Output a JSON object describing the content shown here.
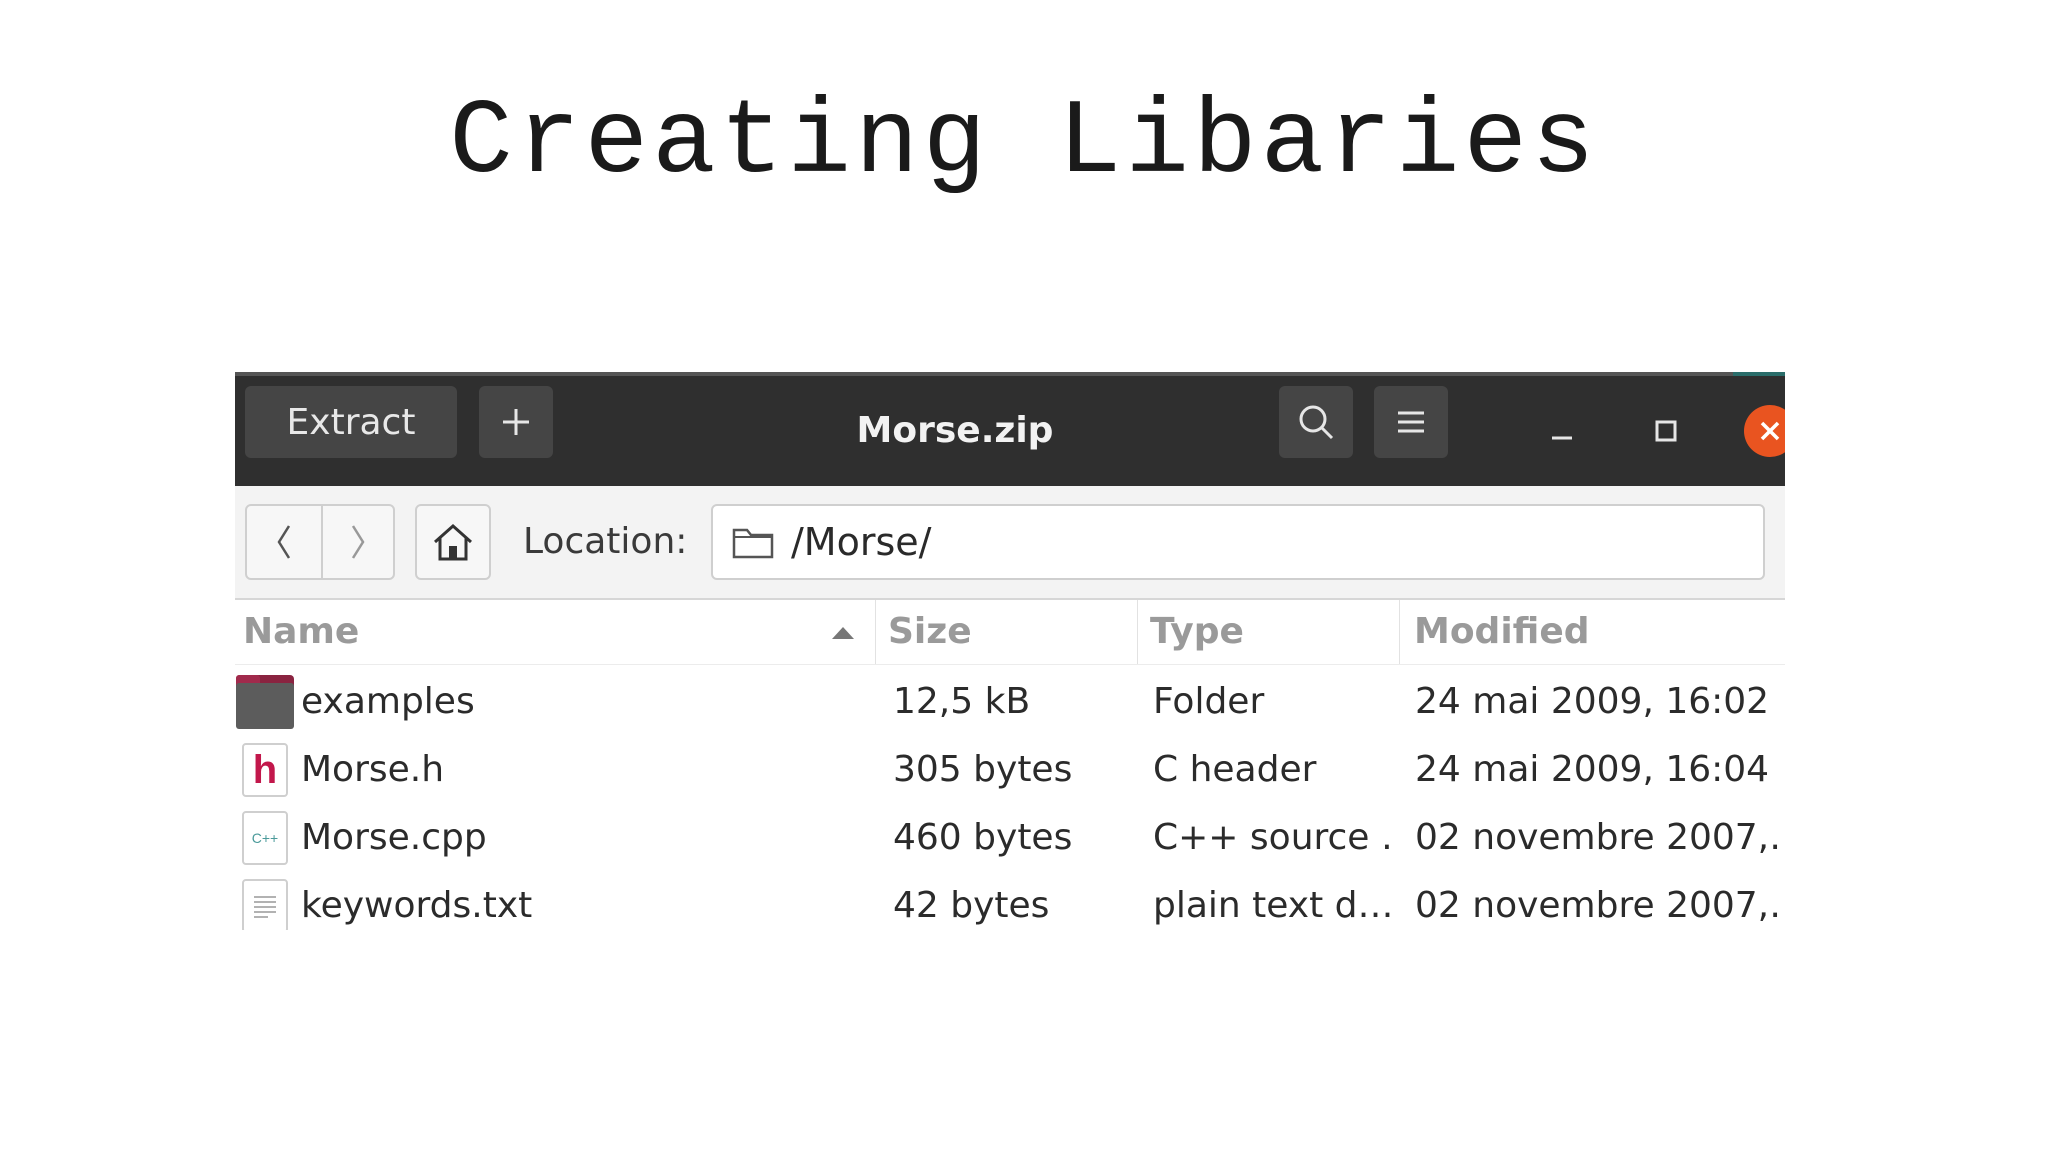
{
  "slide": {
    "title": "Creating Libaries"
  },
  "window": {
    "title": "Morse.zip",
    "extract_label": "Extract",
    "plus_icon": "plus-icon",
    "search_icon": "search-icon",
    "menu_icon": "hamburger-menu-icon",
    "close_color": "#e95420"
  },
  "toolbar": {
    "location_label": "Location:",
    "location_path": "/Morse/"
  },
  "list": {
    "columns": {
      "name": "Name",
      "size": "Size",
      "type": "Type",
      "modified": "Modified"
    },
    "sort": {
      "column": "Name",
      "direction": "ascending"
    },
    "rows": [
      {
        "icon": "folder-icon",
        "name": "examples",
        "size": "12,5 kB",
        "type": "Folder",
        "modified": "24 mai 2009, 16:02"
      },
      {
        "icon": "c-header-file-icon",
        "name": "Morse.h",
        "size": "305 bytes",
        "type": "C header",
        "modified": "24 mai 2009, 16:04"
      },
      {
        "icon": "cpp-source-file-icon",
        "name": "Morse.cpp",
        "size": "460 bytes",
        "type": "C++ source …",
        "modified": "02 novembre 2007,…"
      },
      {
        "icon": "text-file-icon",
        "name": "keywords.txt",
        "size": "42 bytes",
        "type": "plain text d…",
        "modified": "02 novembre 2007,…"
      }
    ]
  }
}
